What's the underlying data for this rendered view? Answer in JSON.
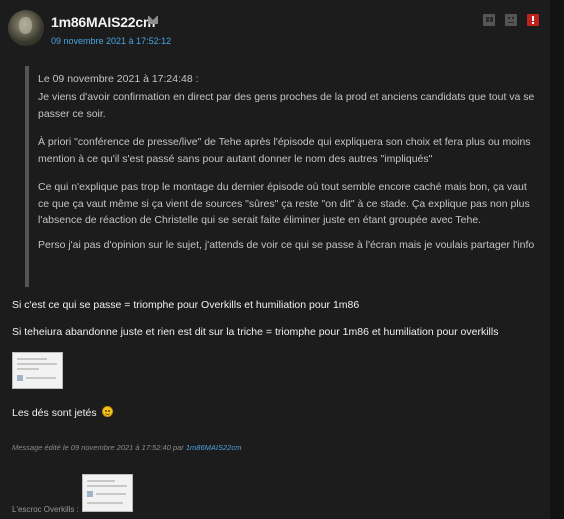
{
  "post": {
    "author": "1m86MAIS22cm",
    "date": "09 novembre 2021 à 17:52:12",
    "quote": {
      "meta": "Le 09 novembre 2021 à 17:24:48 :",
      "paragraphs": [
        "Je viens d'avoir confirmation en direct par des gens proches de la prod et anciens candidats que tout va se passer ce soir.",
        "À priori \"conférence de presse/live\" de Tehe après l'épisode qui expliquera son choix et fera plus ou moins mention à ce qu'il s'est passé sans pour autant donner le nom des autres \"impliqués\"",
        "Ce qui n'explique pas trop le montage du dernier épisode où tout semble encore caché mais bon, ça vaut ce que ça vaut même si ça vient de sources \"sûres\" ça reste \"on dit\" à ce stade. Ça explique pas non plus l'absence de réaction de Christelle qui se serait faite éliminer juste en étant groupée avec Tehe.",
        "Perso j'ai pas d'opinion sur le sujet, j'attends de voir ce qui se passe à l'écran mais je voulais partager l'info"
      ]
    },
    "body": {
      "line1": "Si c'est ce qui se passe = triomphe pour Overkills et humiliation pour 1m86",
      "line2": "Si teheiura abandonne juste et rien est dit sur la triche = triomphe pour 1m86 et humiliation pour overkills",
      "line3": "Les dés sont jetés"
    },
    "edited_prefix": "Message édité le 09 novembre 2021 à 17:52:40 par",
    "edited_author": "1m86MAIS22cm",
    "signature_label": "L'escroc Overkills :"
  },
  "icons": [
    "mail-icon",
    "quote-icon",
    "smiley-face-icon",
    "alert-icon",
    "smiley-emoji-icon"
  ],
  "colors": {
    "link": "#4aa3df",
    "alert": "#c0211d",
    "background": "#1c1c1c"
  }
}
